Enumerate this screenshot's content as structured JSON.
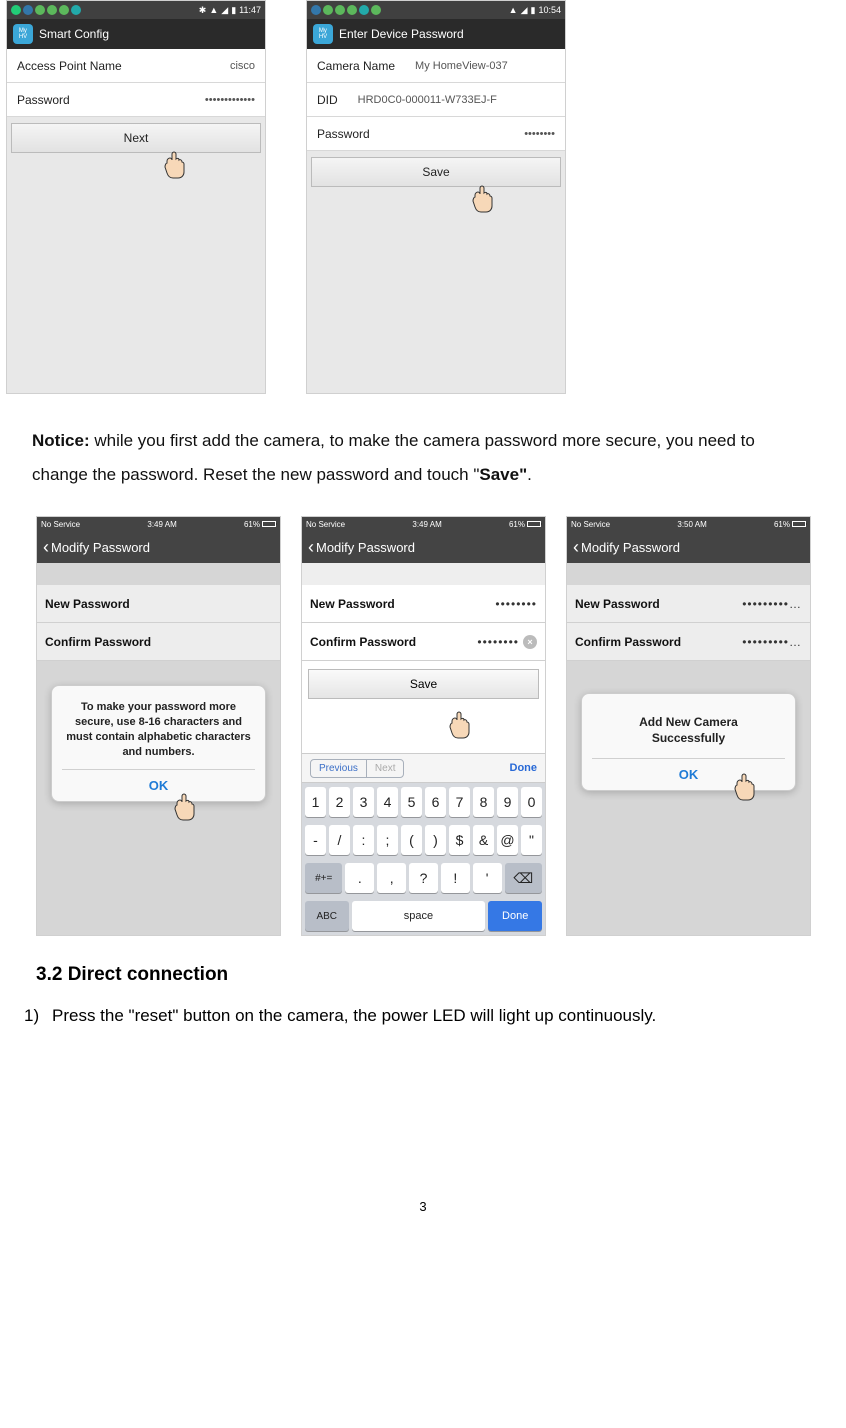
{
  "row1": {
    "a": {
      "status_time": "11:47",
      "title": "Smart Config",
      "apn_label": "Access Point Name",
      "apn_value": "cisco",
      "pwd_label": "Password",
      "pwd_value": "•••••••••••••",
      "next_btn": "Next"
    },
    "b": {
      "status_time": "10:54",
      "title": "Enter Device Password",
      "cam_label": "Camera Name",
      "cam_value": "My HomeView-037",
      "did_label": "DID",
      "did_value": "HRD0C0-000011-W733EJ-F",
      "pwd_label": "Password",
      "pwd_value": "••••••••",
      "save_btn": "Save"
    }
  },
  "notice": {
    "bold": "Notice:",
    "text1": " while you first add the camera, to make the camera password more secure, you need to change the password. Reset the new password and touch \"",
    "save_bold": "Save\"",
    "tail": "."
  },
  "row2": {
    "a": {
      "svc": "No Service",
      "time": "3:49 AM",
      "batt": "61%",
      "title": "Modify Password",
      "new_label": "New Password",
      "conf_label": "Confirm Password",
      "popup_text": "To make your password more secure, use 8-16 characters and must contain alphabetic characters and numbers.",
      "ok": "OK"
    },
    "b": {
      "svc": "No Service",
      "time": "3:49 AM",
      "batt": "61%",
      "title": "Modify Password",
      "new_label": "New Password",
      "new_val": "••••••••",
      "conf_label": "Confirm Password",
      "conf_val": "••••••••",
      "save": "Save",
      "prev": "Previous",
      "next": "Next",
      "done": "Done",
      "kb_r1": [
        "1",
        "2",
        "3",
        "4",
        "5",
        "6",
        "7",
        "8",
        "9",
        "0"
      ],
      "kb_r2": [
        "-",
        "/",
        ":",
        ";",
        "(",
        ")",
        "$",
        "&",
        "@",
        "\""
      ],
      "kb_r3_mode": "#+=",
      "kb_r3": [
        ".",
        ",",
        "?",
        "!",
        "'"
      ],
      "abc": "ABC",
      "space": "space",
      "done2": "Done"
    },
    "c": {
      "svc": "No Service",
      "time": "3:50 AM",
      "batt": "61%",
      "title": "Modify Password",
      "new_label": "New Password",
      "new_val": "•••••••••…",
      "conf_label": "Confirm Password",
      "conf_val": "•••••••••…",
      "popup_text": "Add New Camera Successfully",
      "ok": "OK"
    }
  },
  "section": "3.2 Direct connection",
  "step1_num": "1)",
  "step1_text": "Press the \"reset\" button on the camera, the power LED will light up continuously.",
  "page_num": "3"
}
